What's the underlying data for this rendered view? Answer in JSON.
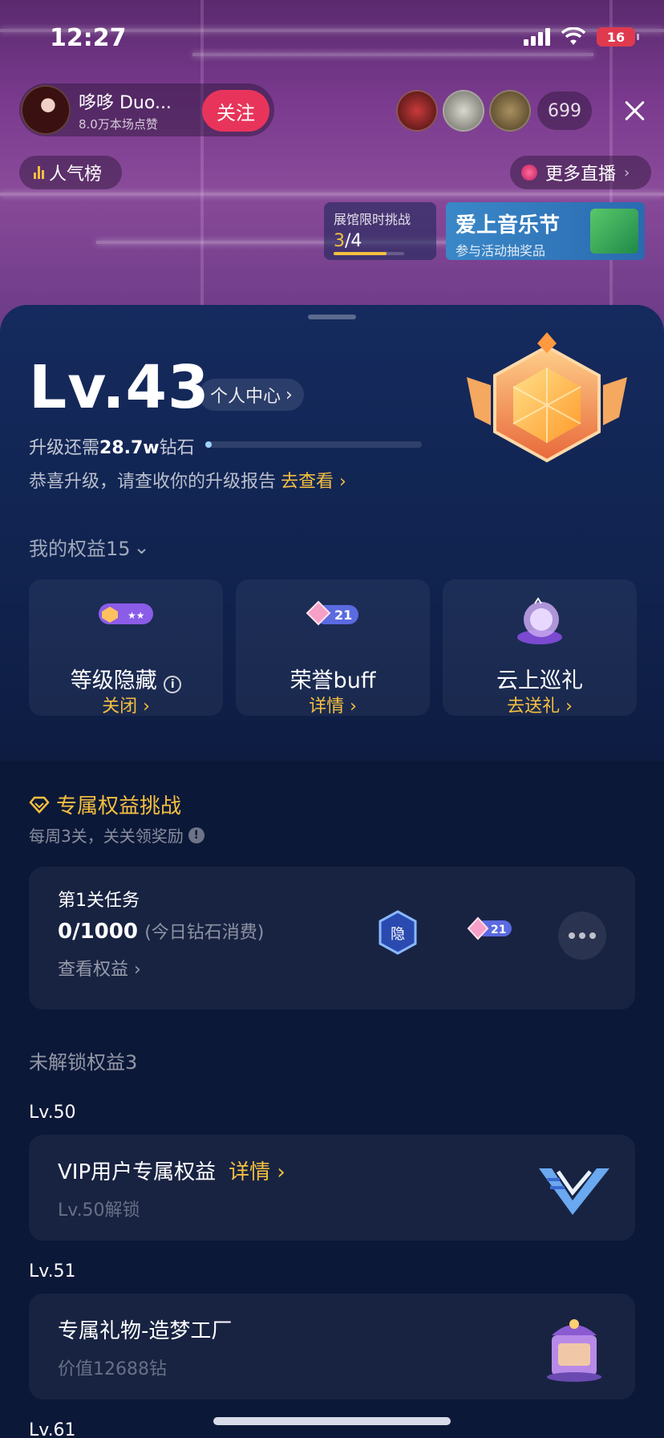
{
  "status_bar": {
    "time": "12:27",
    "battery": "16"
  },
  "live": {
    "host_name": "哆哆 Duo...",
    "host_likes": "8.0万本场点赞",
    "follow_label": "关注",
    "viewer_count": "699",
    "popular_label": "人气榜",
    "more_live_label": "更多直播",
    "challenge_title": "展馆限时挑战",
    "challenge_current": "3",
    "challenge_total": "/4",
    "challenge_progress_fraction": 0.75,
    "festival_title": "爱上音乐节",
    "festival_sub": "参与活动抽奖品"
  },
  "level": {
    "title": "Lv.43",
    "center_label": "个人中心",
    "need_prefix": "升级还需",
    "need_amount": "28.7w",
    "need_suffix": "钻石",
    "progress_fraction": 0.03,
    "report_text": "恭喜升级，请查收你的升级报告",
    "report_link": "去查看"
  },
  "rights": {
    "header": "我的权益15",
    "cards": [
      {
        "name": "等级隐藏",
        "action": "关闭",
        "icon": "level-hide-icon"
      },
      {
        "name": "荣誉buff",
        "action": "详情",
        "icon": "honor-buff-icon",
        "badge": "21"
      },
      {
        "name": "云上巡礼",
        "action": "去送礼",
        "icon": "cloud-tour-icon"
      }
    ]
  },
  "exclusive": {
    "title": "专属权益挑战",
    "subtitle": "每周3关，关关领奖励",
    "task_title": "第1关任务",
    "task_current": "0",
    "task_target": "/1000",
    "task_hint": "(今日钻石消费)",
    "task_link": "查看权益",
    "hide_badge": "隐",
    "buff_badge": "21"
  },
  "locked": {
    "header": "未解锁权益3",
    "items": [
      {
        "level": "Lv.50",
        "name": "VIP用户专属权益",
        "link": "详情",
        "sub": "Lv.50解锁"
      },
      {
        "level": "Lv.51",
        "name": "专属礼物-造梦工厂",
        "sub": "价值12688钻"
      },
      {
        "level": "Lv.61"
      }
    ]
  },
  "colors": {
    "accent_gold": "#f5c040",
    "follow_red": "#e8345a",
    "sheet_bg": "#0c1838"
  }
}
